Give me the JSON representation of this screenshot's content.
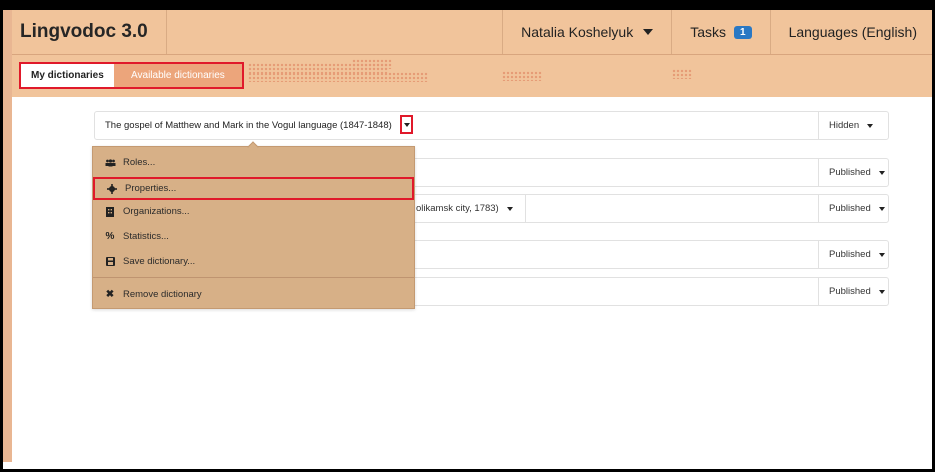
{
  "app": {
    "title": "Lingvodoc 3.0"
  },
  "header": {
    "user": "Natalia Koshelyuk",
    "tasks_label": "Tasks",
    "tasks_count": "1",
    "languages_label": "Languages (English)"
  },
  "tabs": {
    "my": "My dictionaries",
    "available": "Available dictionaries"
  },
  "dictionaries": [
    {
      "title": "The gospel of Matthew and Mark in the Vogul language (1847-1848)",
      "status": "Hidden"
    },
    {
      "title": "",
      "status": "Published"
    },
    {
      "title": "olikamsk city, 1783)",
      "status": "Published"
    },
    {
      "title": "",
      "status": "Published"
    },
    {
      "title": "",
      "status": "Published"
    }
  ],
  "menu": {
    "items": [
      {
        "label": "Roles...",
        "icon": "users-icon"
      },
      {
        "label": "Properties...",
        "icon": "gear-icon"
      },
      {
        "label": "Organizations...",
        "icon": "building-icon"
      },
      {
        "label": "Statistics...",
        "icon": "percent-icon"
      },
      {
        "label": "Save dictionary...",
        "icon": "save-icon"
      },
      {
        "label": "Remove dictionary",
        "icon": "close-icon"
      }
    ]
  }
}
